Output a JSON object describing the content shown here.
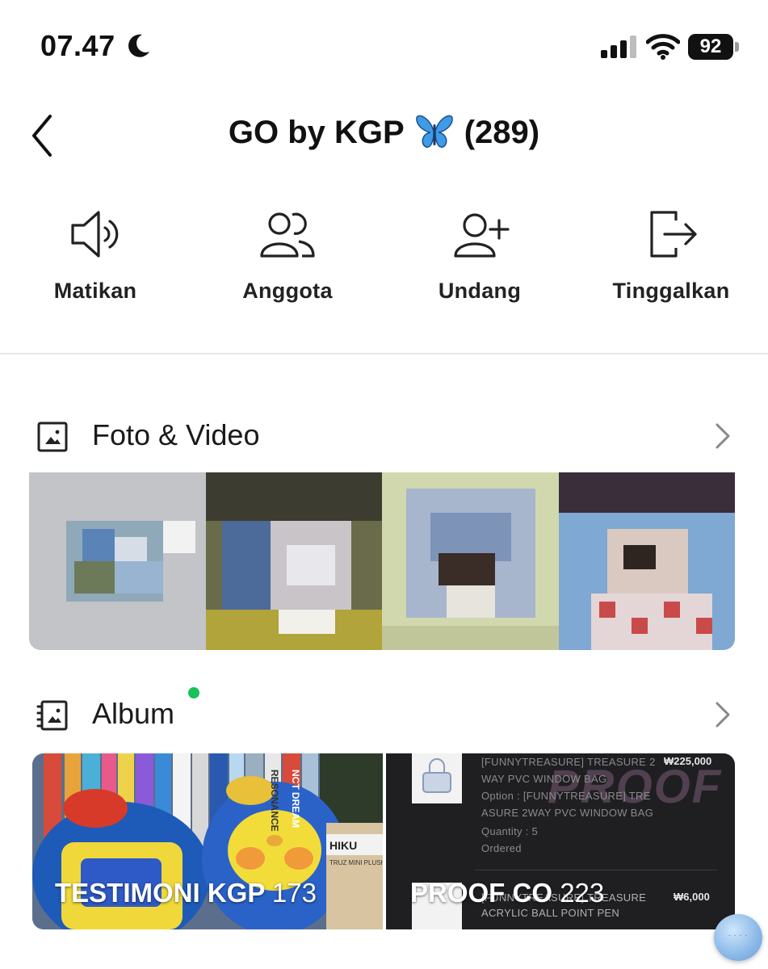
{
  "status_bar": {
    "time": "07.47",
    "battery": "92"
  },
  "header": {
    "title": "GO by KGP",
    "member_count": "(289)"
  },
  "actions": [
    {
      "label": "Matikan",
      "icon": "speaker-icon"
    },
    {
      "label": "Anggota",
      "icon": "members-icon"
    },
    {
      "label": "Undang",
      "icon": "add-user-icon"
    },
    {
      "label": "Tinggalkan",
      "icon": "exit-icon"
    }
  ],
  "photos_section": {
    "title": "Foto & Video"
  },
  "album_section": {
    "title": "Album",
    "albums": [
      {
        "name": "TESTIMONI KGP",
        "count": "173"
      },
      {
        "name": "PROOF CO",
        "count": "223"
      }
    ],
    "thumb_text": {
      "line1": "[FUNNYTREASURE] TREASURE 2",
      "line2": "WAY PVC WINDOW BAG",
      "line3": "Option : [FUNNYTREASURE] TRE",
      "line4": "ASURE 2WAY PVC WINDOW BAG",
      "line5": "Quantity : 5",
      "line6": "Ordered",
      "price1": "₩225,000",
      "line7": "[FUNNYTREASURE] TREASURE",
      "line8": "ACRYLIC BALL POINT PEN",
      "price2": "₩6,000",
      "watermark": "PROOF",
      "box_label": "HIKU",
      "box_sub": "TRUZ MINI PLUSH",
      "spine1": "RESONANCE",
      "spine2": "NCT DREAM"
    }
  },
  "colors": {
    "new_dot": "#19c15a",
    "text": "#111111",
    "divider": "#e8e8e8"
  }
}
